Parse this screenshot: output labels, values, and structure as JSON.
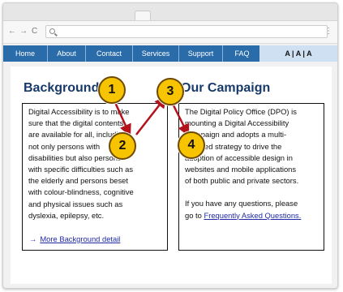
{
  "browser": {
    "back": "←",
    "forward": "→",
    "reload": "C",
    "menu": "⋮"
  },
  "nav": {
    "items": [
      "Home",
      "About",
      "Contact",
      "Services",
      "Support",
      "FAQ"
    ],
    "font_size_control": "A | A | A"
  },
  "left": {
    "heading": "Background",
    "lines": [
      "Digital Accessibility is to make",
      "sure that the digital contents",
      "are available for all, including",
      "not only persons with",
      "disabilities but also persons",
      "with specific difficulties such as",
      "the elderly and persons beset",
      "with colour-blindness, cognitive",
      "and physical issues such as",
      "dyslexia, epilepsy, etc."
    ],
    "more_arrow": "→",
    "more_link": "More Background detail"
  },
  "right": {
    "heading": "Our Campaign",
    "lines": [
      "The Digital Policy Office (DPO) is",
      "mounting a Digital Accessibility",
      "Campaign and adopts a multi-",
      "pronged strategy to drive the",
      "adoption of accessible design in",
      "websites and mobile applications",
      "of both public and private sectors."
    ],
    "question_lines": [
      "If you have any questions, please",
      "go to "
    ],
    "faq_link": "Frequently Asked Questions."
  },
  "callouts": [
    "1",
    "2",
    "3",
    "4"
  ],
  "colors": {
    "nav_bar": "#2a6ca9",
    "heading": "#173a6a",
    "link": "#1f2aa6",
    "callout_fill": "#f6c400",
    "arrow": "#b3121a"
  }
}
